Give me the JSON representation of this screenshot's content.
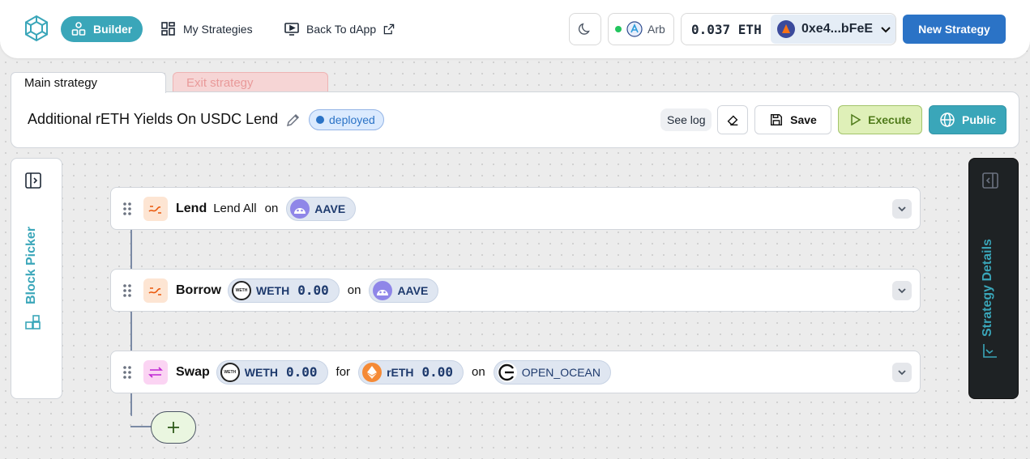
{
  "header": {
    "nav": [
      {
        "label": "Builder",
        "icon": "builder-icon",
        "active": true
      },
      {
        "label": "My Strategies",
        "icon": "grid-icon",
        "active": false
      },
      {
        "label": "Back To dApp",
        "icon": "monitor-icon",
        "active": false
      }
    ],
    "chain": "Arb",
    "balance": "0.037 ETH",
    "address": "0xe4...bFeE",
    "new_strategy_label": "New Strategy"
  },
  "tabs": {
    "main": "Main strategy",
    "exit": "Exit strategy"
  },
  "strategy": {
    "title": "Additional rETH Yields On USDC Lend",
    "status": "deployed",
    "see_log": "See log",
    "save": "Save",
    "execute": "Execute",
    "public": "Public"
  },
  "panels": {
    "block_picker": "Block Picker",
    "strategy_details": "Strategy Details"
  },
  "blocks": [
    {
      "name": "Lend",
      "text": "Lend All",
      "on": "on",
      "protocol": "AAVE"
    },
    {
      "name": "Borrow",
      "token": "WETH",
      "amount": "0.00",
      "on": "on",
      "protocol": "AAVE"
    },
    {
      "name": "Swap",
      "token_from": "WETH",
      "amount_from": "0.00",
      "for": "for",
      "token_to": "rETH",
      "amount_to": "0.00",
      "on": "on",
      "protocol": "OPEN_OCEAN"
    }
  ],
  "colors": {
    "accent": "#3aa6b9",
    "primary": "#2b73c6",
    "execute": "#dff0b8",
    "exit_tab": "#f6d5d5"
  }
}
